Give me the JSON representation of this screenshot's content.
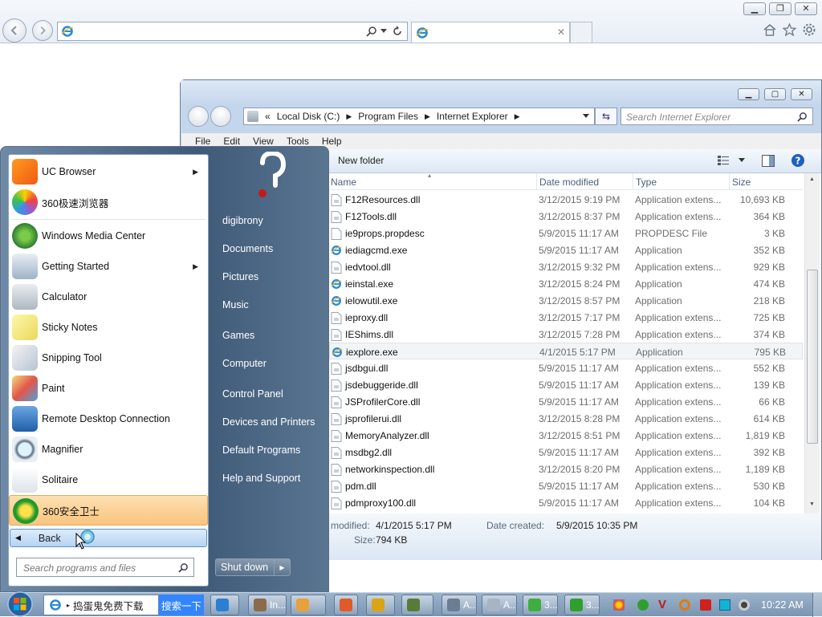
{
  "ie": {
    "tab_close": "✕",
    "icons": [
      "back-icon",
      "forward-icon",
      "ie-logo-icon",
      "search-icon",
      "dropdown-icon",
      "refresh-icon",
      "home-icon",
      "favorites-icon",
      "tools-icon"
    ]
  },
  "explorer": {
    "breadcrumb": {
      "chevrons": "«",
      "parts": [
        "Local Disk (C:)",
        "Program Files",
        "Internet Explorer"
      ]
    },
    "search_placeholder": "Search Internet Explorer",
    "menus": [
      "File",
      "Edit",
      "View",
      "Tools",
      "Help"
    ],
    "new_folder": "New folder",
    "columns": {
      "name": "Name",
      "date": "Date modified",
      "type": "Type",
      "size": "Size"
    },
    "files": [
      {
        "name": "F12Resources.dll",
        "date": "3/12/2015 9:19 PM",
        "type": "Application extens...",
        "size": "10,693 KB",
        "icon": "dll"
      },
      {
        "name": "F12Tools.dll",
        "date": "3/12/2015 8:37 PM",
        "type": "Application extens...",
        "size": "364 KB",
        "icon": "dll"
      },
      {
        "name": "ie9props.propdesc",
        "date": "5/9/2015 11:17 AM",
        "type": "PROPDESC File",
        "size": "3 KB",
        "icon": "file"
      },
      {
        "name": "iediagcmd.exe",
        "date": "5/9/2015 11:17 AM",
        "type": "Application",
        "size": "352 KB",
        "icon": "ie"
      },
      {
        "name": "iedvtool.dll",
        "date": "3/12/2015 9:32 PM",
        "type": "Application extens...",
        "size": "929 KB",
        "icon": "dll"
      },
      {
        "name": "ieinstal.exe",
        "date": "3/12/2015 8:24 PM",
        "type": "Application",
        "size": "474 KB",
        "icon": "ie"
      },
      {
        "name": "ielowutil.exe",
        "date": "3/12/2015 8:57 PM",
        "type": "Application",
        "size": "218 KB",
        "icon": "ie"
      },
      {
        "name": "ieproxy.dll",
        "date": "3/12/2015 7:17 PM",
        "type": "Application extens...",
        "size": "725 KB",
        "icon": "dll"
      },
      {
        "name": "IEShims.dll",
        "date": "3/12/2015 7:28 PM",
        "type": "Application extens...",
        "size": "374 KB",
        "icon": "dll"
      },
      {
        "name": "iexplore.exe",
        "date": "4/1/2015 5:17 PM",
        "type": "Application",
        "size": "795 KB",
        "icon": "ie",
        "selected": true
      },
      {
        "name": "jsdbgui.dll",
        "date": "5/9/2015 11:17 AM",
        "type": "Application extens...",
        "size": "552 KB",
        "icon": "dll"
      },
      {
        "name": "jsdebuggeride.dll",
        "date": "5/9/2015 11:17 AM",
        "type": "Application extens...",
        "size": "139 KB",
        "icon": "dll"
      },
      {
        "name": "JSProfilerCore.dll",
        "date": "5/9/2015 11:17 AM",
        "type": "Application extens...",
        "size": "66 KB",
        "icon": "dll"
      },
      {
        "name": "jsprofilerui.dll",
        "date": "3/12/2015 8:28 PM",
        "type": "Application extens...",
        "size": "614 KB",
        "icon": "dll"
      },
      {
        "name": "MemoryAnalyzer.dll",
        "date": "3/12/2015 8:51 PM",
        "type": "Application extens...",
        "size": "1,819 KB",
        "icon": "dll"
      },
      {
        "name": "msdbg2.dll",
        "date": "5/9/2015 11:17 AM",
        "type": "Application extens...",
        "size": "392 KB",
        "icon": "dll"
      },
      {
        "name": "networkinspection.dll",
        "date": "3/12/2015 8:20 PM",
        "type": "Application extens...",
        "size": "1,189 KB",
        "icon": "dll"
      },
      {
        "name": "pdm.dll",
        "date": "5/9/2015 11:17 AM",
        "type": "Application extens...",
        "size": "530 KB",
        "icon": "dll"
      },
      {
        "name": "pdmproxy100.dll",
        "date": "5/9/2015 11:17 AM",
        "type": "Application extens...",
        "size": "104 KB",
        "icon": "dll"
      }
    ],
    "details": {
      "modified_label": "modified:",
      "modified_value": "4/1/2015 5:17 PM",
      "created_label": "Date created:",
      "created_value": "5/9/2015 10:35 PM",
      "size_label": "Size:",
      "size_value": "794 KB"
    }
  },
  "start_menu": {
    "programs": [
      {
        "label": "UC Browser",
        "arrow": "▶",
        "icon": "uc-browser-icon"
      },
      {
        "label": "360极速浏览器",
        "icon": "360-browser-icon"
      },
      {
        "label": "Windows Media Center",
        "icon": "media-center-icon"
      },
      {
        "label": "Getting Started",
        "arrow": "▶",
        "icon": "getting-started-icon"
      },
      {
        "label": "Calculator",
        "icon": "calculator-icon"
      },
      {
        "label": "Sticky Notes",
        "icon": "sticky-notes-icon"
      },
      {
        "label": "Snipping Tool",
        "icon": "snipping-tool-icon"
      },
      {
        "label": "Paint",
        "icon": "paint-icon"
      },
      {
        "label": "Remote Desktop Connection",
        "icon": "remote-desktop-icon"
      },
      {
        "label": "Magnifier",
        "icon": "magnifier-icon"
      },
      {
        "label": "Solitaire",
        "icon": "solitaire-icon"
      },
      {
        "label": "360安全卫士",
        "icon": "360-security-icon",
        "highlight": true
      }
    ],
    "back_label": "Back",
    "search_placeholder": "Search programs and files",
    "right_items": [
      "digibrony",
      "Documents",
      "Pictures",
      "Music",
      "Games",
      "Computer",
      "Control Panel",
      "Devices and Printers",
      "Default Programs",
      "Help and Support"
    ],
    "shutdown_label": "Shut down"
  },
  "taskbar": {
    "baidu_text": "捣蛋鬼免费下载",
    "baidu_button": "搜索一下",
    "buttons": [
      {
        "label": "",
        "color": "#2a7fd4"
      },
      {
        "label": "In...",
        "color": "#8b6b4a"
      },
      {
        "label": "",
        "color": "#e8a13a"
      },
      {
        "label": "",
        "color": "#e05a2a"
      },
      {
        "label": "",
        "color": "#d9a514"
      },
      {
        "label": "",
        "color": "#5a7a3a"
      },
      {
        "label": "A...",
        "color": "#6a7d92"
      },
      {
        "label": "A...",
        "color": "#a8b4c2"
      },
      {
        "label": "3...",
        "color": "#3fae3f"
      },
      {
        "label": "3...",
        "color": "#2fa02f"
      }
    ],
    "clock": "10:22 AM"
  },
  "colors": {
    "accent": "#3399ff",
    "highlight": "#fbd29a",
    "taskbar": "#8aa4bf"
  }
}
